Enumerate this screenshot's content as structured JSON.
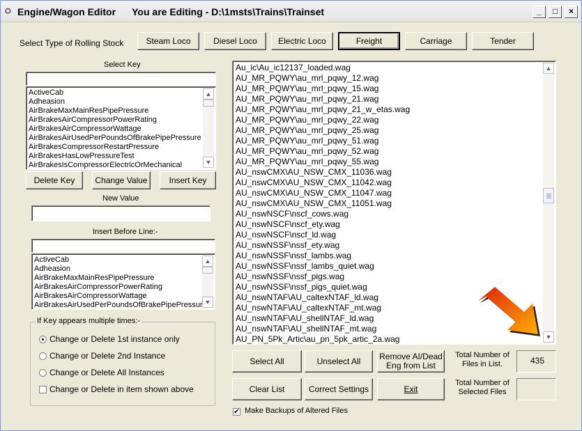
{
  "window": {
    "title": "Engine/Wagon Editor",
    "editing_text": "You are Editing - D:\\1msts\\Trains\\Trainset",
    "controls": [
      "_",
      "□",
      "×"
    ]
  },
  "stock_type": {
    "label": "Select Type of Rolling Stock",
    "buttons": [
      "Steam Loco",
      "Diesel Loco",
      "Electric Loco",
      "Freight",
      "Carriage",
      "Tender"
    ],
    "selected": "Freight"
  },
  "select_key": {
    "label": "Select Key",
    "value": "",
    "items": [
      "ActiveCab",
      "Adheasion",
      "AirBrakeMaxMainResPipePressure",
      "AirBrakesAirCompressorPowerRating",
      "AirBrakesAirCompressorWattage",
      "AirBrakesAirUsedPerPoundsOfBrakePipePressure",
      "AirBrakesCompressorRestartPressure",
      "AirBrakesHasLowPressureTest",
      "AirBrakesIsCompressorElectricOrMechanical"
    ]
  },
  "key_buttons": {
    "delete": "Delete Key",
    "change": "Change Value",
    "insert": "Insert Key"
  },
  "new_value": {
    "label": "New Value",
    "value": ""
  },
  "insert_before": {
    "label": "Insert Before Line:-",
    "value": "",
    "items": [
      "ActiveCab",
      "Adheasion",
      "AirBrakeMaxMainResPipePressure",
      "AirBrakesAirCompressorPowerRating",
      "AirBrakesAirCompressorWattage",
      "AirBrakesAirUsedPerPoundsOfBrakePipePressure"
    ]
  },
  "multiple": {
    "legend": "If Key appears multiple times:-",
    "options": [
      "Change or Delete 1st instance only",
      "Change or Delete 2nd Instance",
      "Change or Delete All Instances"
    ],
    "selected_index": 0,
    "checkbox_label": "Change or Delete in item shown above",
    "checkbox_checked": false
  },
  "files": {
    "items": [
      "Au_ic\\Au_ic12137_loaded.wag",
      "AU_MR_PQWY\\au_mrl_pqwy_12.wag",
      "AU_MR_PQWY\\au_mrl_pqwy_15.wag",
      "AU_MR_PQWY\\au_mrl_pqwy_21.wag",
      "AU_MR_PQWY\\au_mrl_pqwy_21_w_etas.wag",
      "AU_MR_PQWY\\au_mrl_pqwy_22.wag",
      "AU_MR_PQWY\\au_mrl_pqwy_25.wag",
      "AU_MR_PQWY\\au_mrl_pqwy_51.wag",
      "AU_MR_PQWY\\au_mrl_pqwy_52.wag",
      "AU_MR_PQWY\\au_mrl_pqwy_55.wag",
      "AU_nswCMX\\AU_NSW_CMX_11036.wag",
      "AU_nswCMX\\AU_NSW_CMX_11042.wag",
      "AU_nswCMX\\AU_NSW_CMX_11047.wag",
      "AU_nswCMX\\AU_NSW_CMX_11051.wag",
      "AU_nswNSCF\\nscf_cows.wag",
      "AU_nswNSCF\\nscf_ety.wag",
      "AU_nswNSCF\\nscf_ld.wag",
      "AU_nswNSSF\\nssf_ety.wag",
      "AU_nswNSSF\\nssf_lambs.wag",
      "AU_nswNSSF\\nssf_lambs_quiet.wag",
      "AU_nswNSSF\\nssf_pigs.wag",
      "AU_nswNSSF\\nssf_pigs_quiet.wag",
      "AU_nswNTAF\\AU_caltexNTAF_ld.wag",
      "AU_nswNTAF\\AU_caltexNTAF_mt.wag",
      "AU_nswNTAF\\AU_shellNTAF_ld.wag",
      "AU_nswNTAF\\AU_shellNTAF_mt.wag",
      "AU_PN_5Pk_Artic\\au_pn_5pk_artic_2a.wag"
    ],
    "scroll_fraction": 0.47
  },
  "actions": {
    "select_all": "Select All",
    "unselect_all": "Unselect All",
    "remove_line1": "Remove AI/Dead",
    "remove_line2": "Eng from List",
    "clear_list": "Clear List",
    "correct_settings": "Correct Settings",
    "exit": "Exit"
  },
  "totals": {
    "files_label_1": "Total Number of",
    "files_label_2": "Files in List.",
    "files_value": "435",
    "selected_label_1": "Total Number of",
    "selected_label_2": "Selected Files",
    "selected_value": ""
  },
  "backup": {
    "label": "Make Backups of Altered Files",
    "checked": true
  },
  "colors": {
    "face": "#ece9d8",
    "arrow_red": "#e0200c",
    "arrow_yellow": "#ffb000"
  }
}
